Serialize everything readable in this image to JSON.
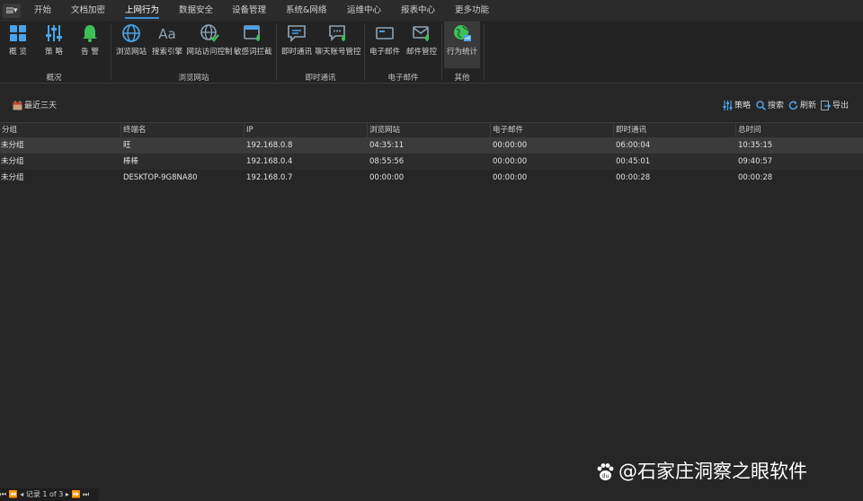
{
  "menu": {
    "app_icon": "▤▾",
    "tabs": [
      {
        "label": "开始",
        "active": false
      },
      {
        "label": "文档加密",
        "active": false
      },
      {
        "label": "上网行为",
        "active": true
      },
      {
        "label": "数据安全",
        "active": false
      },
      {
        "label": "设备管理",
        "active": false
      },
      {
        "label": "系统&网络",
        "active": false
      },
      {
        "label": "运维中心",
        "active": false
      },
      {
        "label": "报表中心",
        "active": false
      },
      {
        "label": "更多功能",
        "active": false
      }
    ]
  },
  "ribbon": {
    "groups": [
      {
        "label": "概况",
        "buttons": [
          {
            "label": "概 览",
            "icon": "overview-grid-icon"
          },
          {
            "label": "策 略",
            "icon": "policy-sliders-icon"
          },
          {
            "label": "告 警",
            "icon": "alarm-bell-icon"
          }
        ]
      },
      {
        "label": "浏览网站",
        "buttons": [
          {
            "label": "浏览网站",
            "icon": "globe-icon"
          },
          {
            "label": "搜索引擎",
            "icon": "search-engine-aa-icon"
          },
          {
            "label": "网站访问控制",
            "icon": "globe-check-icon"
          },
          {
            "label": "敏感词拦截",
            "icon": "sensitive-word-block-icon"
          }
        ]
      },
      {
        "label": "即时通讯",
        "buttons": [
          {
            "label": "即时通讯",
            "icon": "chat-bubble-icon"
          },
          {
            "label": "聊天账号管控",
            "icon": "chat-account-control-icon"
          }
        ]
      },
      {
        "label": "电子邮件",
        "buttons": [
          {
            "label": "电子邮件",
            "icon": "email-icon"
          },
          {
            "label": "邮件管控",
            "icon": "email-control-icon"
          }
        ]
      },
      {
        "label": "其他",
        "buttons": [
          {
            "label": "行为统计",
            "icon": "behavior-stats-globe-icon",
            "selected": true
          }
        ]
      }
    ]
  },
  "toolbar": {
    "range_label": "最近三天",
    "policy_label": "策略",
    "search_label": "搜索",
    "refresh_label": "刷新",
    "export_label": "导出"
  },
  "table": {
    "columns": [
      "分组",
      "终端名",
      "IP",
      "浏览网站",
      "电子邮件",
      "即时通讯",
      "总时间"
    ],
    "rows": [
      [
        "未分组",
        "旺",
        "192.168.0.8",
        "04:35:11",
        "00:00:00",
        "06:00:04",
        "10:35:15"
      ],
      [
        "未分组",
        "棒棒",
        "192.168.0.4",
        "08:55:56",
        "00:00:00",
        "00:45:01",
        "09:40:57"
      ],
      [
        "未分组",
        "DESKTOP-9G8NA80",
        "192.168.0.7",
        "00:00:00",
        "00:00:00",
        "00:00:28",
        "00:00:28"
      ]
    ]
  },
  "pager": {
    "label": "记录 1 of 3"
  },
  "watermark": {
    "text": "@石家庄洞察之眼软件"
  },
  "colors": {
    "accent": "#3d8fd6",
    "icon_blue": "#4aa3e8",
    "icon_green": "#3fbf5a"
  }
}
